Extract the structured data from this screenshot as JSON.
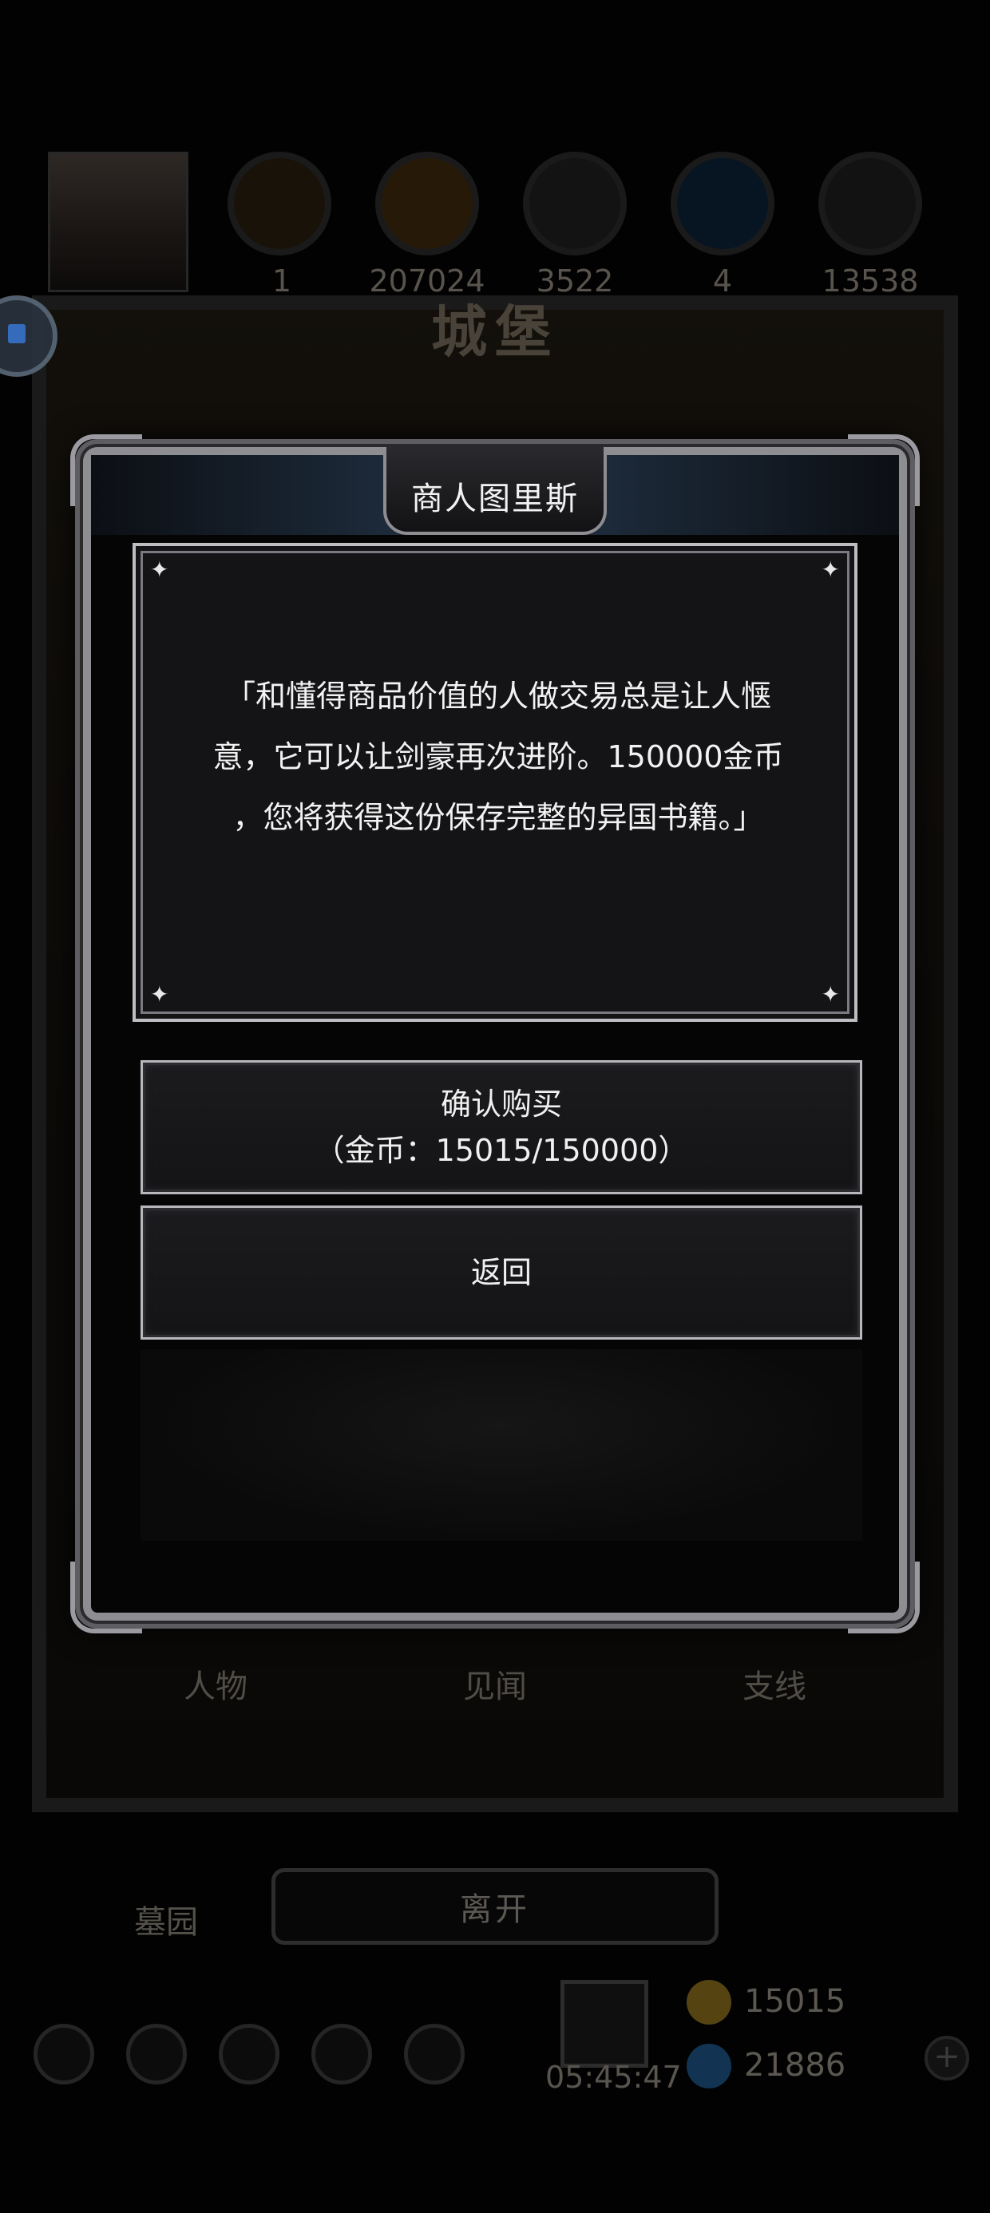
{
  "background": {
    "resources": [
      "1",
      "207024",
      "3522",
      "4",
      "13538"
    ],
    "castle_title": "城堡",
    "tabs": [
      "人物",
      "见闻",
      "支线"
    ],
    "leave_label": "离开",
    "graveyard_label": "墓园",
    "timer": "05:45:47",
    "gold": "15015",
    "gems": "21886"
  },
  "dialog": {
    "title": "商人图里斯",
    "message": "「和懂得商品价值的人做交易总是让人惬\n意，它可以让剑豪再次进阶。150000金币\n，您将获得这份保存完整的异国书籍。」",
    "confirm": {
      "label": "确认购买",
      "cost": "（金币：15015/150000）"
    },
    "back_label": "返回"
  },
  "colors": {
    "dialog_border": "#8e8e92",
    "panel_bg": "#141417",
    "text": "#f2f2f2",
    "header_blue": "#223245"
  }
}
